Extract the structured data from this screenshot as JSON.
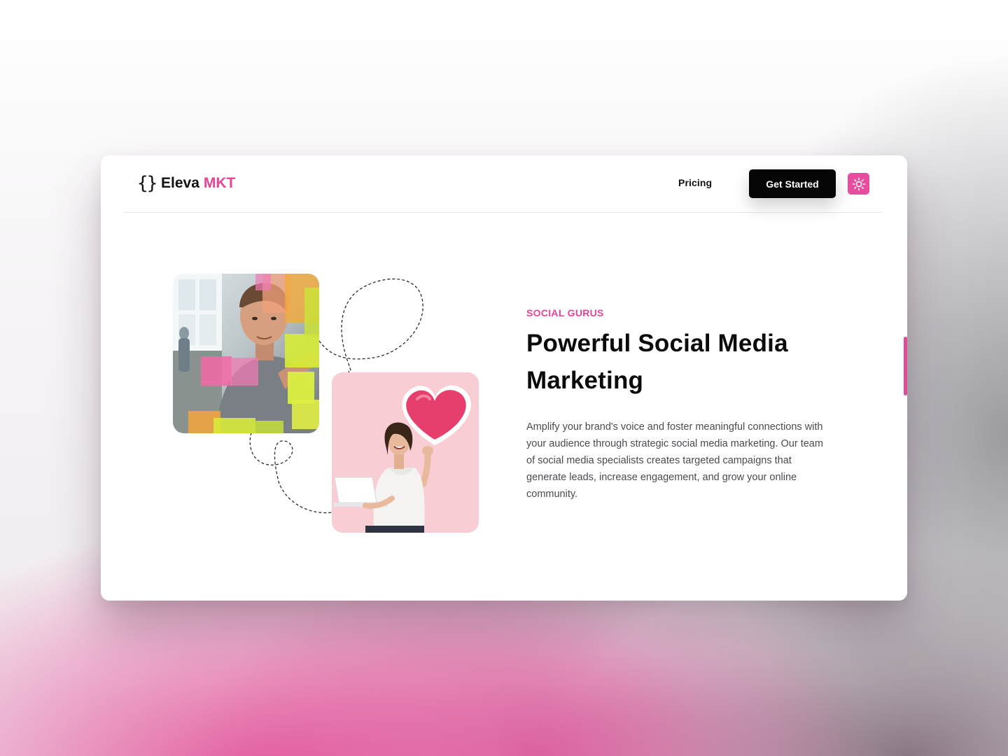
{
  "brand": {
    "icon": "curly-braces-icon",
    "icon_glyph": "{}",
    "name": "Eleva",
    "accent": "MKT",
    "accent_color": "#e5449a"
  },
  "nav": {
    "pricing_label": "Pricing",
    "cta_label": "Get Started",
    "theme_toggle_icon": "sun-icon",
    "theme_toggle_color": "#e84c9f"
  },
  "hero": {
    "eyebrow": "SOCIAL GURUS",
    "headline": "Powerful Social Media Marketing",
    "body": "Amplify your brand's voice and foster meaningful connections with your audience through strategic social media marketing. Our team of social media specialists creates targeted campaigns that generate leads, increase engagement, and grow your online community."
  },
  "images": [
    {
      "name": "man-with-sticky-notes-photo"
    },
    {
      "name": "woman-with-heart-and-laptop-photo"
    }
  ]
}
